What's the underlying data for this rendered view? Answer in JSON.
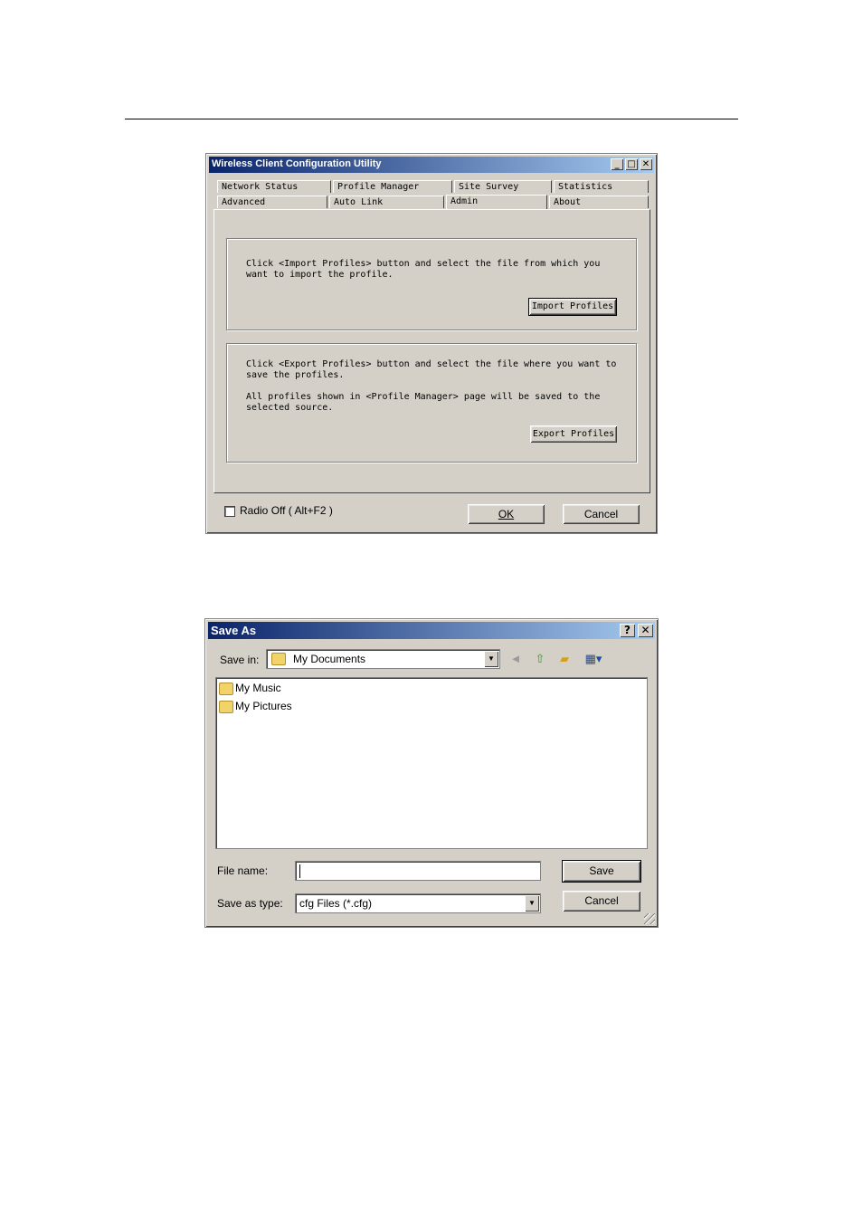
{
  "wcu_dialog": {
    "title": "Wireless Client Configuration Utility",
    "tabs_row1": [
      "Network Status",
      "Profile Manager",
      "Site Survey",
      "Statistics"
    ],
    "tabs_row2": [
      "Advanced",
      "Auto Link",
      "Admin",
      "About"
    ],
    "active_tab": "Admin",
    "import_text": "Click <Import Profiles> button and select the file from which you want to import the profile.",
    "import_button": "Import Profiles",
    "export_text1": "Click <Export Profiles> button and select the file where you want to save the profiles.",
    "export_text2": "All profiles shown in <Profile Manager> page will be saved to the selected source.",
    "export_button": "Export Profiles",
    "radio_off_label": "Radio Off ( Alt+F2 )",
    "ok_button": "OK",
    "cancel_button": "Cancel"
  },
  "saveas_dialog": {
    "title": "Save As",
    "help_glyph": "?",
    "close_glyph": "✕",
    "save_in_label": "Save in:",
    "save_in_value": "My Documents",
    "files": [
      "My Music",
      "My Pictures"
    ],
    "file_name_label": "File name:",
    "file_name_value": "",
    "save_as_type_label": "Save as type:",
    "save_as_type_value": "cfg Files (*.cfg)",
    "save_button": "Save",
    "cancel_button": "Cancel"
  }
}
